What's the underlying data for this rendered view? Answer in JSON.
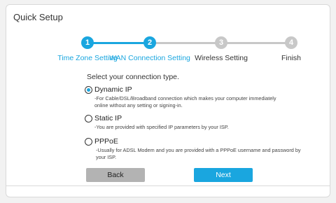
{
  "header": {
    "title": "Quick Setup"
  },
  "steps": [
    {
      "number": "1",
      "label": "Time Zone Setting",
      "state": "done"
    },
    {
      "number": "2",
      "label": "WAN Connection Setting",
      "state": "current"
    },
    {
      "number": "3",
      "label": "Wireless Setting",
      "state": "pending"
    },
    {
      "number": "4",
      "label": "Finish",
      "state": "pending"
    }
  ],
  "prompt": "Select your connection type.",
  "options": [
    {
      "label": "Dynamic IP",
      "description": "-For Cable/DSL/Broadband connection which makes your computer immediately\nonline without any setting or signing-in.",
      "selected": true
    },
    {
      "label": "Static IP",
      "description": "-You are provided with specified IP parameters by your ISP.",
      "selected": false
    },
    {
      "label": "PPPoE",
      "description": "-Usually for ADSL Modem and you are provided with a PPPoE username and password by\nyour ISP.",
      "selected": false
    }
  ],
  "buttons": {
    "back": "Back",
    "next": "Next"
  },
  "colors": {
    "accent": "#1aa6df",
    "inactive": "#c8c8c8",
    "back_button": "#b3b3b3"
  }
}
